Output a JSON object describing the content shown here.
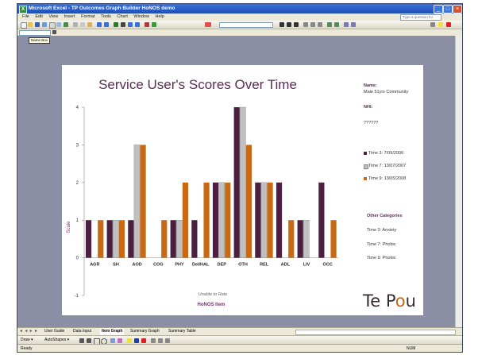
{
  "window": {
    "title": "Microsoft Excel - TP Outcomes Graph Builder HoNOS demo",
    "app_icon": "excel-icon",
    "ask_placeholder": "Type a question for help"
  },
  "menu": [
    "File",
    "Edit",
    "View",
    "Insert",
    "Format",
    "Tools",
    "Chart",
    "Window",
    "Help"
  ],
  "tooltip": "Name Box",
  "sheet_tabs": [
    "User Guide",
    "Data Input",
    "Item Graph",
    "Summary Graph",
    "Summary Table"
  ],
  "active_tab": "Item Graph",
  "draw": {
    "draw_label": "Draw ▾",
    "autoshapes_label": "AutoShapes ▾"
  },
  "status": {
    "left": "Ready",
    "right": "NUM"
  },
  "colors": {
    "time3": "#4b2040",
    "time7": "#c0c0c0",
    "time9": "#c96a12",
    "title": "#5c2c55"
  },
  "panel": {
    "name_label": "Name:",
    "name_value": "Male 51yrs Community",
    "nhi_label": "NHI:",
    "nhi_value": "??????",
    "legend": [
      "Time 3: 7/09/2006",
      "Time 7: 13/07/2007",
      "Time 9: 13/05/2008"
    ],
    "other_label": "Other Categories",
    "other_items": [
      "Time 3:   Anxiety",
      "Time 7:   Phobic",
      "Time 9:   Phobic"
    ]
  },
  "logo": {
    "text_a": "Te P",
    "text_b": "o",
    "text_c": "u"
  },
  "chart_data": {
    "type": "bar",
    "title": "Service User's Scores Over Time",
    "xlabel": "HoNOS Item",
    "ylabel": "Scale",
    "ylim": [
      -1,
      4
    ],
    "yticks": [
      -1,
      0,
      1,
      2,
      3,
      4
    ],
    "annotation": "Unable to Rate",
    "categories": [
      "AGR",
      "SH",
      "AOD",
      "COG",
      "PHY",
      "Del/HAL",
      "DEP",
      "OTH",
      "REL",
      "ADL",
      "LIV",
      "OCC"
    ],
    "series": [
      {
        "name": "Time 3: 7/09/2006",
        "values": [
          1,
          1,
          1,
          0,
          1,
          1,
          2,
          4,
          2,
          2,
          1,
          2
        ]
      },
      {
        "name": "Time 7: 13/07/2007",
        "values": [
          0,
          1,
          3,
          0,
          1,
          0,
          2,
          4,
          2,
          0,
          1,
          0
        ]
      },
      {
        "name": "Time 9: 13/05/2008",
        "values": [
          1,
          1,
          3,
          1,
          2,
          2,
          2,
          3,
          2,
          1,
          0,
          1
        ]
      }
    ]
  }
}
